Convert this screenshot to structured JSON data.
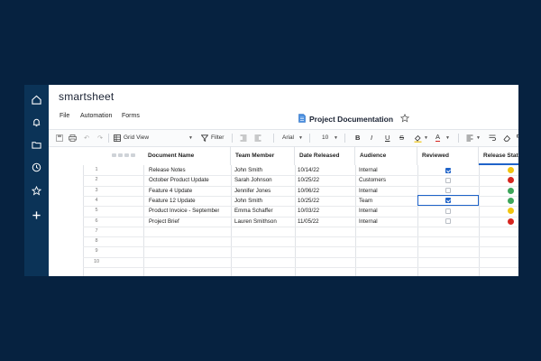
{
  "app": {
    "brand": "smartsheet"
  },
  "nav": {
    "icons": [
      "home-icon",
      "bell-icon",
      "folder-icon",
      "clock-icon",
      "star-icon",
      "plus-icon"
    ]
  },
  "menu": {
    "file": "File",
    "automation": "Automation",
    "forms": "Forms"
  },
  "document": {
    "title": "Project Documentation"
  },
  "toolbar": {
    "view": "Grid View",
    "filter": "Filter",
    "font": "Arial",
    "size": "10",
    "bold": "B",
    "italic": "I",
    "underline": "U",
    "strike": "S",
    "text_color": "A"
  },
  "columns": {
    "doc": "Document Name",
    "member": "Team Member",
    "date": "Date Released",
    "audience": "Audience",
    "reviewed": "Reviewed",
    "status": "Release Status"
  },
  "rows": [
    {
      "num": "1",
      "doc": "Release Notes",
      "member": "John Smith",
      "date": "10/14/22",
      "audience": "Internal",
      "reviewed": true,
      "status": "yellow"
    },
    {
      "num": "2",
      "doc": "October Product Update",
      "member": "Sarah Johnson",
      "date": "10/25/22",
      "audience": "Customers",
      "reviewed": false,
      "status": "red"
    },
    {
      "num": "3",
      "doc": "Feature 4 Update",
      "member": "Jennifer Jones",
      "date": "10/06/22",
      "audience": "Internal",
      "reviewed": false,
      "status": "green"
    },
    {
      "num": "4",
      "doc": "Feature 12 Update",
      "member": "John Smith",
      "date": "10/25/22",
      "audience": "Team",
      "reviewed": true,
      "status": "green"
    },
    {
      "num": "5",
      "doc": "Product Invoice - September",
      "member": "Emma Schaffer",
      "date": "10/03/22",
      "audience": "Internal",
      "reviewed": false,
      "status": "yellow"
    },
    {
      "num": "6",
      "doc": "Project Brief",
      "member": "Lauren Smithson",
      "date": "11/05/22",
      "audience": "Internal",
      "reviewed": false,
      "status": "red"
    }
  ],
  "empty_rows": [
    "7",
    "8",
    "9",
    "10"
  ],
  "colors": {
    "background": "#062240",
    "nav": "#0b3357",
    "accent": "#1f63c9",
    "green": "#3da55a",
    "yellow": "#f1c40f",
    "red": "#d6251f"
  }
}
